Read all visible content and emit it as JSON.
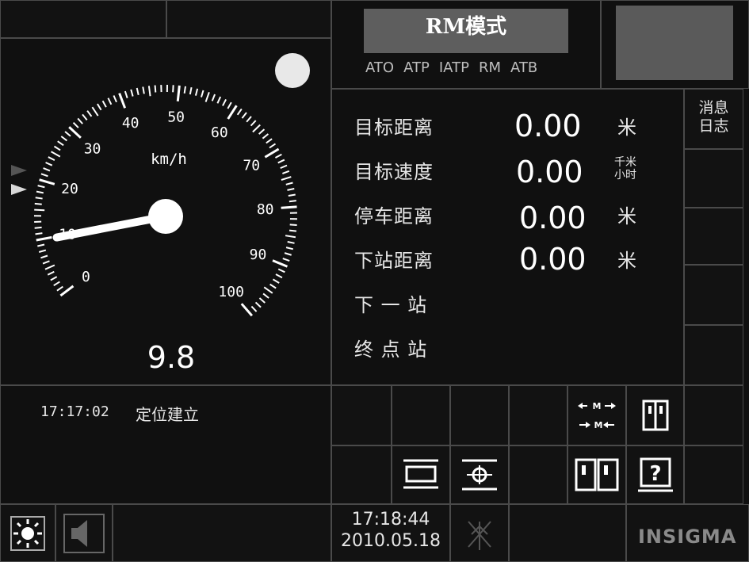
{
  "mode": {
    "title": "RM模式",
    "tabs": [
      "ATO",
      "ATP",
      "IATP",
      "RM",
      "ATB"
    ]
  },
  "speedometer": {
    "unit": "km/h",
    "ticks": [
      "0",
      "10",
      "20",
      "30",
      "40",
      "50",
      "60",
      "70",
      "80",
      "90",
      "100"
    ],
    "current_speed": "9.8",
    "needle_value": 9.8
  },
  "info_rows": [
    {
      "label": "目标距离",
      "value": "0.00",
      "unit": "米"
    },
    {
      "label": "目标速度",
      "value": "0.00",
      "unit_top": "千米",
      "unit_bottom": "小时"
    },
    {
      "label": "停车距离",
      "value": "0.00",
      "unit": "米"
    },
    {
      "label": "下站距离",
      "value": "0.00",
      "unit": "米"
    },
    {
      "label": "下 一 站"
    },
    {
      "label": "终 点 站"
    }
  ],
  "message_log": {
    "line1": "消息",
    "line2": "日志"
  },
  "event_log": {
    "time": "17:17:02",
    "text": "定位建立"
  },
  "clock": {
    "time": "17:18:44",
    "date": "2010.05.18"
  },
  "logo": "INSIGMA",
  "icons": {
    "brightness": "sun-icon",
    "volume": "speaker-icon",
    "antenna": "antenna-off-icon",
    "door_mode": "door-mode-icon",
    "door_single": "door-single-icon",
    "door_double": "door-double-icon",
    "door_question": "door-question-icon",
    "platform": "platform-icon",
    "target": "target-icon"
  }
}
